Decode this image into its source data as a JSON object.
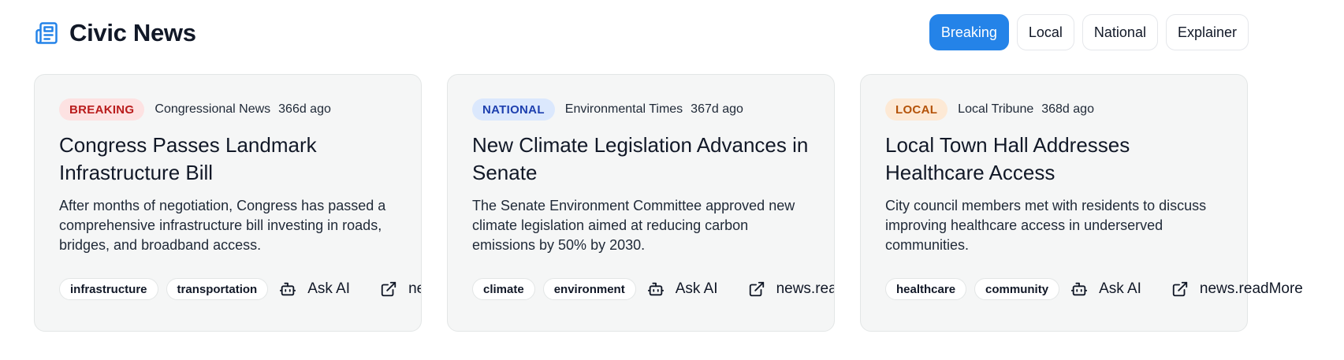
{
  "app": {
    "title": "Civic News",
    "icon": "newspaper-icon"
  },
  "filters": [
    {
      "label": "Breaking",
      "active": true
    },
    {
      "label": "Local",
      "active": false
    },
    {
      "label": "National",
      "active": false
    },
    {
      "label": "Explainer",
      "active": false
    }
  ],
  "cards": [
    {
      "badge": "BREAKING",
      "badge_color": "#b91c1c",
      "source": "Congressional News",
      "time": "366d ago",
      "title": "Congress Passes Landmark Infrastructure Bill",
      "summary": "After months of negotiation, Congress has passed a comprehensive infrastructure bill investing in roads, bridges, and broadband access.",
      "tags": [
        "infrastructure",
        "transportation"
      ],
      "ask_label": "Ask AI",
      "read_label": "news.readMore"
    },
    {
      "badge": "NATIONAL",
      "badge_color": "#1e40af",
      "source": "Environmental Times",
      "time": "367d ago",
      "title": "New Climate Legislation Advances in Senate",
      "summary": "The Senate Environment Committee approved new climate legislation aimed at reducing carbon emissions by 50% by 2030.",
      "tags": [
        "climate",
        "environment"
      ],
      "ask_label": "Ask AI",
      "read_label": "news.readMore"
    },
    {
      "badge": "LOCAL",
      "badge_color": "#b45309",
      "source": "Local Tribune",
      "time": "368d ago",
      "title": "Local Town Hall Addresses Healthcare Access",
      "summary": "City council members met with residents to discuss improving healthcare access in underserved communities.",
      "tags": [
        "healthcare",
        "community"
      ],
      "ask_label": "Ask AI",
      "read_label": "news.readMore"
    }
  ],
  "colors": {
    "accent": "#2483e8",
    "card_bg": "#f5f6f6"
  }
}
